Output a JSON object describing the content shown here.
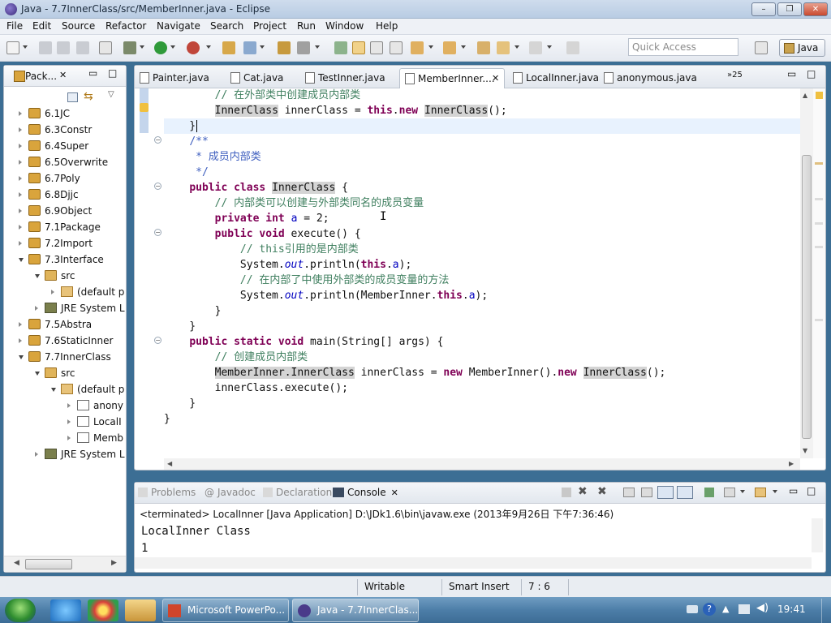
{
  "window": {
    "title": "Java - 7.7InnerClass/src/MemberInner.java - Eclipse",
    "min": "–",
    "max": "❐",
    "close": "✕"
  },
  "menu": [
    "File",
    "Edit",
    "Source",
    "Refactor",
    "Navigate",
    "Search",
    "Project",
    "Run",
    "Window",
    "Help"
  ],
  "toolbar": {
    "quick_access": "Quick Access",
    "perspective": "Java"
  },
  "package_explorer": {
    "title": "Pack...",
    "items": [
      {
        "label": "6.1JC",
        "depth": 0,
        "icon": "proj",
        "expanded": false
      },
      {
        "label": "6.3Constr",
        "depth": 0,
        "icon": "proj",
        "expanded": false
      },
      {
        "label": "6.4Super",
        "depth": 0,
        "icon": "proj",
        "expanded": false
      },
      {
        "label": "6.5Overwrite",
        "depth": 0,
        "icon": "proj",
        "expanded": false
      },
      {
        "label": "6.7Poly",
        "depth": 0,
        "icon": "proj",
        "expanded": false
      },
      {
        "label": "6.8Djjc",
        "depth": 0,
        "icon": "proj",
        "expanded": false
      },
      {
        "label": "6.9Object",
        "depth": 0,
        "icon": "proj",
        "expanded": false
      },
      {
        "label": "7.1Package",
        "depth": 0,
        "icon": "proj",
        "expanded": false
      },
      {
        "label": "7.2Import",
        "depth": 0,
        "icon": "proj",
        "expanded": false
      },
      {
        "label": "7.3Interface",
        "depth": 0,
        "icon": "proj",
        "expanded": true
      },
      {
        "label": "src",
        "depth": 1,
        "icon": "src",
        "expanded": true
      },
      {
        "label": "(default p",
        "depth": 2,
        "icon": "pk",
        "expanded": false
      },
      {
        "label": "JRE System L",
        "depth": 1,
        "icon": "jre",
        "expanded": false
      },
      {
        "label": "7.5Abstra",
        "depth": 0,
        "icon": "proj",
        "expanded": false
      },
      {
        "label": "7.6StaticInner",
        "depth": 0,
        "icon": "proj",
        "expanded": false
      },
      {
        "label": "7.7InnerClass",
        "depth": 0,
        "icon": "proj",
        "expanded": true
      },
      {
        "label": "src",
        "depth": 1,
        "icon": "src",
        "expanded": true
      },
      {
        "label": "(default p",
        "depth": 2,
        "icon": "pk",
        "expanded": true
      },
      {
        "label": "anony",
        "depth": 3,
        "icon": "jf",
        "expanded": false
      },
      {
        "label": "LocalI",
        "depth": 3,
        "icon": "jf",
        "expanded": false
      },
      {
        "label": "Memb",
        "depth": 3,
        "icon": "jf",
        "expanded": false
      },
      {
        "label": "JRE System L",
        "depth": 1,
        "icon": "jre",
        "expanded": false
      }
    ]
  },
  "editor": {
    "tabs": [
      "Painter.java",
      "Cat.java",
      "TestInner.java",
      "MemberInner....",
      "LocalInner.java",
      "anonymous.java"
    ],
    "active_tab": 3,
    "more_tabs": "»25"
  },
  "console": {
    "tabs": [
      "Problems",
      "Javadoc",
      "Declaration",
      "Console"
    ],
    "active_tab": 3,
    "terminated": "<terminated> LocalInner [Java Application] D:\\JDk1.6\\bin\\javaw.exe (2013年9月26日 下午7:36:46)",
    "output": [
      "LocalInner Class",
      "1"
    ]
  },
  "status": {
    "writable": "Writable",
    "insert_mode": "Smart Insert",
    "position": "7 : 6"
  },
  "taskbar": {
    "tasks": [
      "Microsoft PowerPo...",
      "Java - 7.7InnerClas..."
    ],
    "time": "19:41"
  }
}
